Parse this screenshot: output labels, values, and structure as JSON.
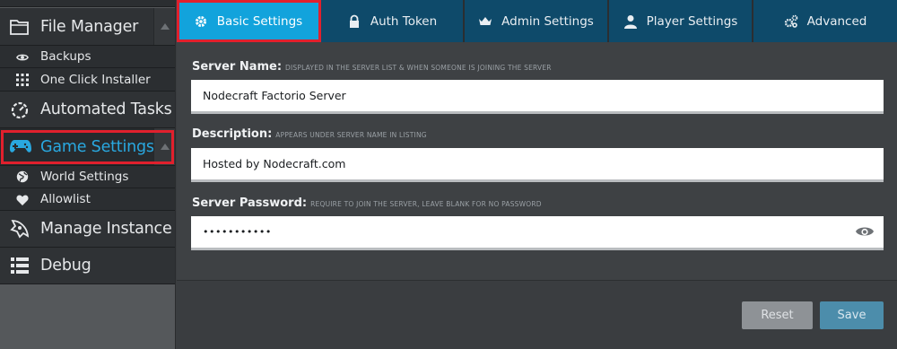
{
  "sidebar": {
    "file_manager": "File Manager",
    "backups": "Backups",
    "one_click_installer": "One Click Installer",
    "automated_tasks": "Automated Tasks",
    "game_settings": "Game Settings",
    "world_settings": "World Settings",
    "allowlist": "Allowlist",
    "manage_instance": "Manage Instance",
    "debug": "Debug"
  },
  "tabs": {
    "basic": "Basic Settings",
    "auth": "Auth Token",
    "admin": "Admin Settings",
    "player": "Player Settings",
    "advanced": "Advanced"
  },
  "form": {
    "server_name_label": "Server Name:",
    "server_name_hint": "DISPLAYED IN THE SERVER LIST & WHEN SOMEONE IS JOINING THE SERVER",
    "server_name_value": "Nodecraft Factorio Server",
    "description_label": "Description:",
    "description_hint": "APPEARS UNDER SERVER NAME IN LISTING",
    "description_value": "Hosted by Nodecraft.com",
    "password_label": "Server Password:",
    "password_hint": "REQUIRE TO JOIN THE SERVER, LEAVE BLANK FOR NO PASSWORD",
    "password_value": "•••••••••••"
  },
  "buttons": {
    "reset": "Reset",
    "save": "Save"
  },
  "colors": {
    "tab_active": "#12a3dc",
    "tab_inactive": "#0e4a6a",
    "accent_game_settings": "#29a8e0",
    "highlight": "#e1202d"
  },
  "icons": {
    "file_manager": "folder-icon",
    "backups": "eye-icon",
    "one_click_installer": "grid-icon",
    "automated_tasks": "timer-icon",
    "game_settings": "gamepad-icon",
    "world_settings": "globe-icon",
    "allowlist": "heart-icon",
    "manage_instance": "rocket-icon",
    "debug": "list-icon"
  }
}
